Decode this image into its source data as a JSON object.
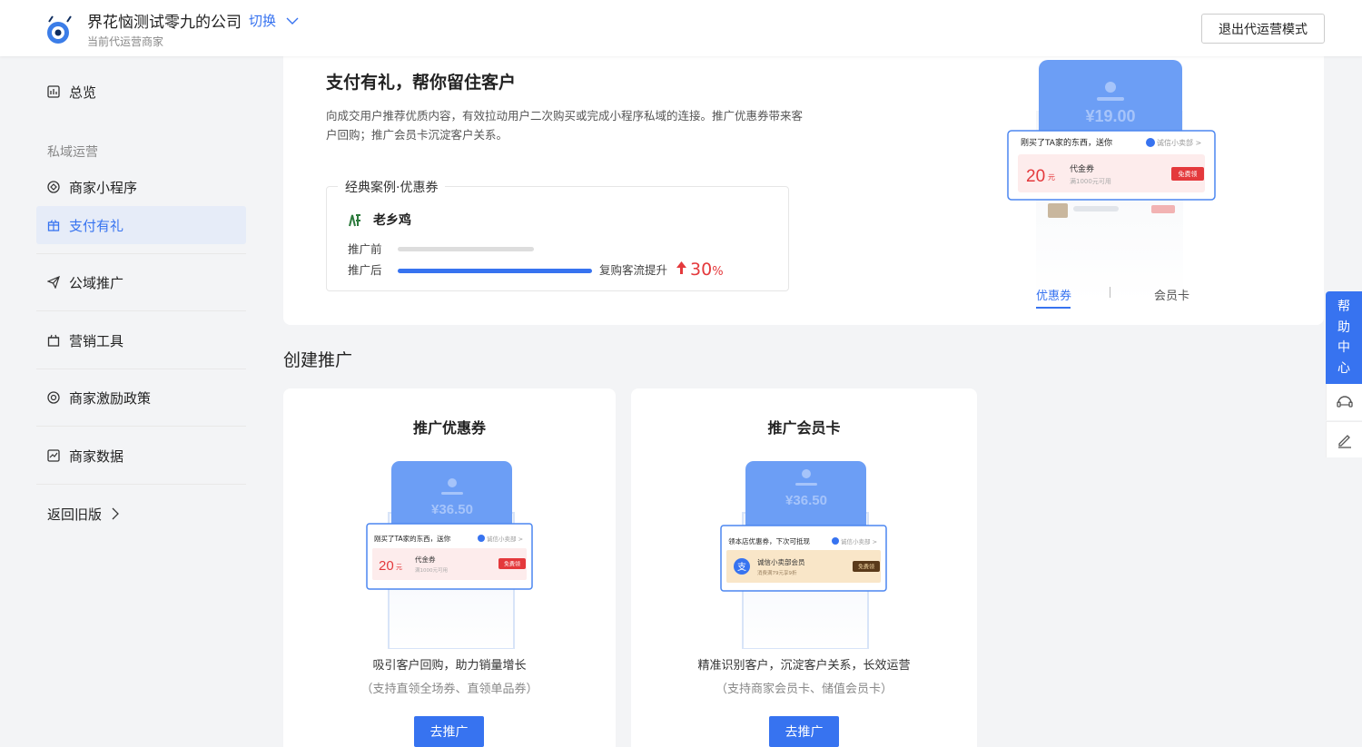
{
  "header": {
    "company_name": "界花恼测试零九的公司",
    "switch_label": "切换",
    "subtitle": "当前代运营商家",
    "exit_button": "退出代运营模式"
  },
  "sidebar": {
    "overview": "总览",
    "group_label": "私域运营",
    "items": [
      {
        "label": "商家小程序",
        "icon": "mini-program-icon",
        "active": false
      },
      {
        "label": "支付有礼",
        "icon": "gift-icon",
        "active": true
      },
      {
        "label": "公域推广",
        "icon": "paper-plane-icon",
        "active": false
      },
      {
        "label": "营销工具",
        "icon": "gift-box-icon",
        "active": false
      },
      {
        "label": "商家激励政策",
        "icon": "incentive-icon",
        "active": false
      },
      {
        "label": "商家数据",
        "icon": "chart-icon",
        "active": false
      }
    ],
    "back_old": "返回旧版"
  },
  "hero": {
    "title": "支付有礼，帮你留住客户",
    "description": "向成交用户推荐优质内容，有效拉动用户二次购买或完成小程序私域的连接。推广优惠券带来客户回购；推广会员卡沉淀客户关系。",
    "case": {
      "title": "经典案例·优惠券",
      "brand": "老乡鸡",
      "before_label": "推广前",
      "after_label": "推广后",
      "lift_text": "复购客流提升",
      "lift_value": "30",
      "lift_unit": "%"
    },
    "preview": {
      "amount": "¥19.00",
      "popup_title": "刚买了TA家的东西，送你",
      "shop": "诚信小卖部 >",
      "price": "20",
      "price_unit": "元",
      "coupon_name": "代金券",
      "coupon_cond": "满1000元可用",
      "claim": "免费领",
      "tabs": [
        "优惠券",
        "会员卡"
      ]
    }
  },
  "section_title": "创建推广",
  "cards": [
    {
      "title": "推广优惠券",
      "amount": "¥36.50",
      "popup_title": "刚买了TA家的东西，送你",
      "shop": "诚信小卖部 >",
      "price": "20",
      "price_unit": "元",
      "item_name": "代金券",
      "item_cond": "满1000元可用",
      "claim": "免费领",
      "desc": "吸引客户回购，助力销量增长",
      "sub": "（支持直领全场券、直领单品券）",
      "button": "去推广"
    },
    {
      "title": "推广会员卡",
      "amount": "¥36.50",
      "popup_title": "领本店优惠券，下次可抵现",
      "shop": "诚信小卖部 >",
      "item_name": "诚信小卖部会员",
      "item_cond": "消费满79元享9折",
      "claim": "免费领",
      "desc": "精准识别客户，沉淀客户关系，长效运营",
      "sub": "（支持商家会员卡、储值会员卡）",
      "button": "去推广"
    }
  ],
  "help": {
    "label": "帮助中心"
  },
  "colors": {
    "accent": "#3773f0",
    "red": "#e4393c",
    "background": "#f3f4f6"
  }
}
